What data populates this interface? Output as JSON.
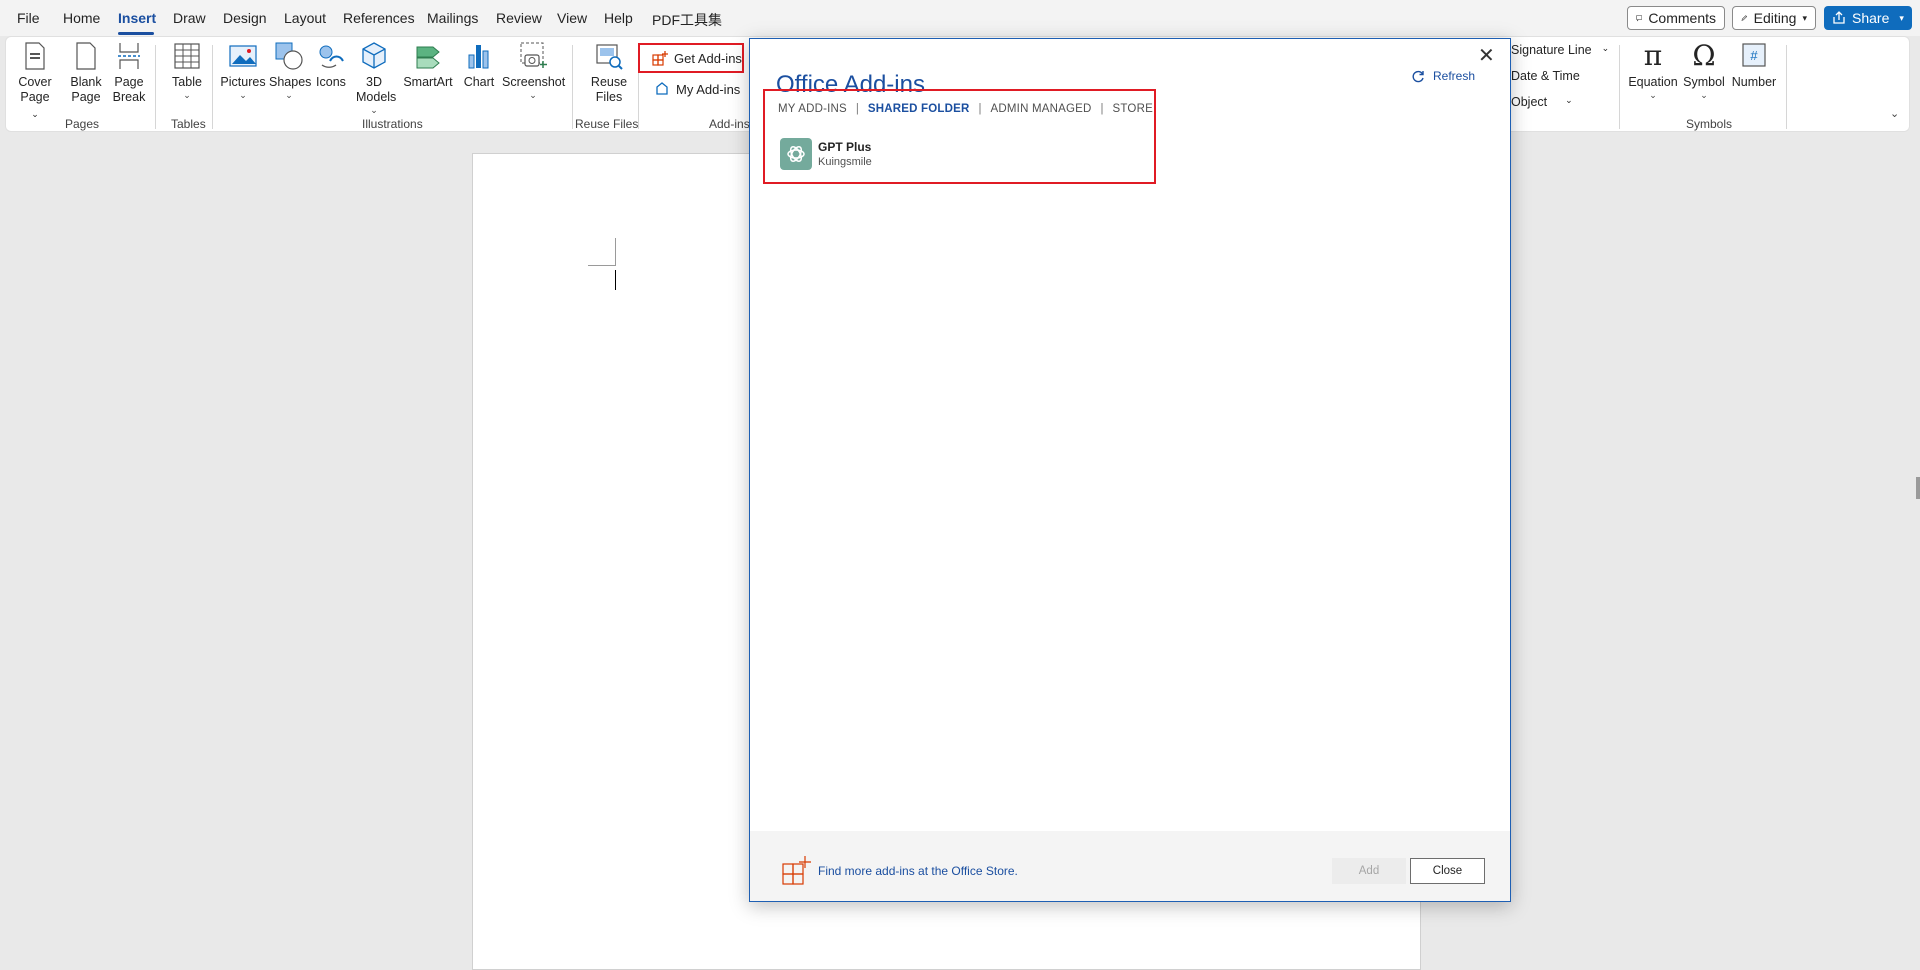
{
  "menubar": {
    "items": [
      "File",
      "Home",
      "Insert",
      "Draw",
      "Design",
      "Layout",
      "References",
      "Mailings",
      "Review",
      "View",
      "Help",
      "PDF工具集"
    ],
    "active": "Insert",
    "comments_label": "Comments",
    "editing_label": "Editing",
    "share_label": "Share"
  },
  "ribbon": {
    "pages": {
      "cover_page": [
        "Cover",
        "Page"
      ],
      "blank_page": [
        "Blank",
        "Page"
      ],
      "page_break": [
        "Page",
        "Break"
      ],
      "group": "Pages"
    },
    "tables": {
      "table": "Table",
      "group": "Tables"
    },
    "illustrations": {
      "pictures": "Pictures",
      "shapes": "Shapes",
      "icons": "Icons",
      "models_3d": [
        "3D",
        "Models"
      ],
      "smartart": "SmartArt",
      "chart": "Chart",
      "screenshot": "Screenshot",
      "group": "Illustrations"
    },
    "reuse": {
      "reuse_files": [
        "Reuse",
        "Files"
      ],
      "group": "Reuse Files"
    },
    "addins": {
      "get_addins": "Get Add-ins",
      "my_addins": "My Add-ins",
      "group": "Add-ins"
    },
    "text": {
      "signature_line": "Signature Line",
      "date_time": "Date & Time",
      "object": "Object"
    },
    "symbols": {
      "equation": "Equation",
      "symbol": "Symbol",
      "number": "Number",
      "group": "Symbols"
    }
  },
  "dialog": {
    "title": "Office Add-ins",
    "refresh_label": "Refresh",
    "tabs": [
      {
        "label": "MY ADD-INS",
        "active": false
      },
      {
        "label": "SHARED FOLDER",
        "active": true
      },
      {
        "label": "ADMIN MANAGED",
        "active": false
      },
      {
        "label": "STORE",
        "active": false
      }
    ],
    "addins": [
      {
        "name": "GPT Plus",
        "publisher": "Kuingsmile",
        "icon": "openai-icon"
      }
    ],
    "footer_link": "Find more add-ins at the Office Store.",
    "add_label": "Add",
    "close_label": "Close"
  },
  "colors": {
    "accent": "#1b4fa0",
    "highlight": "#e01b24",
    "share_bg": "#0f6cbd",
    "addin_logo": "#74aa9c"
  }
}
